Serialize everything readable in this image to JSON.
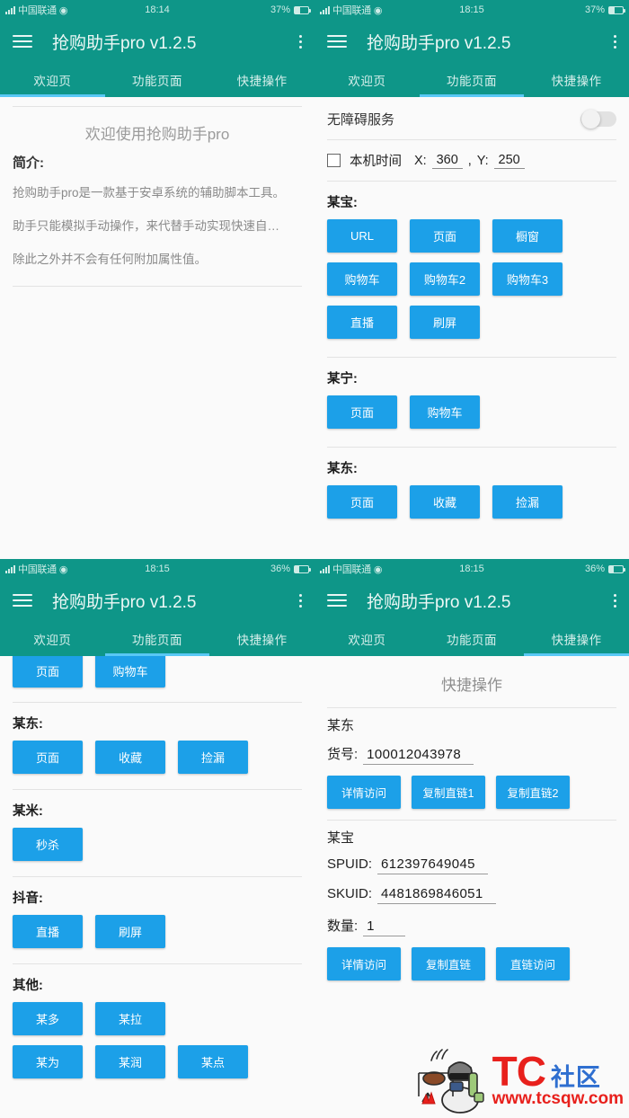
{
  "app": {
    "title": "抢购助手pro v1.2.5",
    "menu_icon": "hamburger-icon",
    "overflow_icon": "kebab-menu-icon",
    "header_color": "#0E9688",
    "accent_button_color": "#1CA0E8",
    "tab_indicator_color": "#59c8f5"
  },
  "tabs": [
    {
      "label": "欢迎页"
    },
    {
      "label": "功能页面"
    },
    {
      "label": "快捷操作"
    }
  ],
  "panels": [
    {
      "status": {
        "carrier": "中国联通",
        "time": "18:14",
        "battery": "37%"
      },
      "active_tab": 0
    },
    {
      "status": {
        "carrier": "中国联通",
        "time": "18:15",
        "battery": "37%"
      },
      "active_tab": 1
    },
    {
      "status": {
        "carrier": "中国联通",
        "time": "18:15",
        "battery": "36%"
      },
      "active_tab": 1
    },
    {
      "status": {
        "carrier": "中国联通",
        "time": "18:15",
        "battery": "36%"
      },
      "active_tab": 2
    }
  ],
  "welcome": {
    "title": "欢迎使用抢购助手pro",
    "intro_label": "简介:",
    "paragraphs": [
      "抢购助手pro是一款基于安卓系统的辅助脚本工具。",
      "助手只能模拟手动操作，来代替手动实现快速自…",
      "除此之外并不会有任何附加属性值。"
    ]
  },
  "functional": {
    "service_label": "无障碍服务",
    "service_enabled": false,
    "local_time_label": "本机时间",
    "local_time_checked": false,
    "x_label": "X:",
    "x_value": "360",
    "comma": ",",
    "y_label": "Y:",
    "y_value": "250",
    "groups": [
      {
        "name": "某宝:",
        "rows": [
          [
            "URL",
            "页面",
            "橱窗"
          ],
          [
            "购物车",
            "购物车2",
            "购物车3"
          ],
          [
            "直播",
            "刷屏"
          ]
        ]
      },
      {
        "name": "某宁:",
        "rows": [
          [
            "页面",
            "购物车"
          ]
        ]
      },
      {
        "name": "某东:",
        "rows": [
          [
            "页面",
            "收藏",
            "捡漏"
          ]
        ]
      }
    ]
  },
  "functional_scrolled": {
    "clipped_row": [
      "页面",
      "购物车"
    ],
    "groups": [
      {
        "name": "某东:",
        "rows": [
          [
            "页面",
            "收藏",
            "捡漏"
          ]
        ]
      },
      {
        "name": "某米:",
        "rows": [
          [
            "秒杀"
          ]
        ]
      },
      {
        "name": "抖音:",
        "rows": [
          [
            "直播",
            "刷屏"
          ]
        ]
      },
      {
        "name": "其他:",
        "rows": [
          [
            "某多",
            "某拉"
          ],
          [
            "某为",
            "某润",
            "某点"
          ]
        ]
      }
    ]
  },
  "quick": {
    "title": "快捷操作",
    "sections": [
      {
        "name": "某东",
        "fields": [
          {
            "key": "货号:",
            "value": "100012043978"
          }
        ],
        "buttons": [
          "详情访问",
          "复制直链1",
          "复制直链2"
        ]
      },
      {
        "name": "某宝",
        "fields": [
          {
            "key": "SPUID:",
            "value": "612397649045"
          },
          {
            "key": "SKUID:",
            "value": "4481869846051"
          },
          {
            "key": "数量:",
            "value": "1"
          }
        ],
        "buttons": [
          "详情访问",
          "复制直链",
          "直链访问"
        ]
      }
    ]
  },
  "watermark": {
    "brand": "TC",
    "brand_cn": "社区",
    "url": "www.tcsqw.com",
    "brand_color": "#e8201c",
    "cn_color": "#2f6fd0"
  }
}
